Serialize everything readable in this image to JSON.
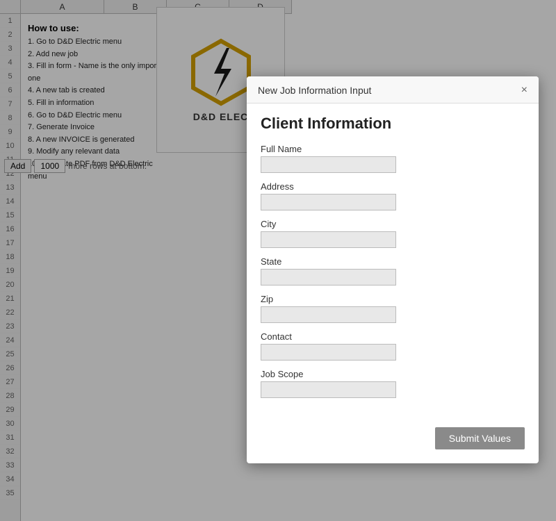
{
  "spreadsheet": {
    "col_headers": [
      "A",
      "B",
      "C",
      "D"
    ],
    "row_numbers": [
      "1",
      "2",
      "3",
      "4",
      "5",
      "6",
      "7",
      "8",
      "9",
      "10",
      "11",
      "12",
      "13",
      "14",
      "15",
      "16",
      "17",
      "18",
      "19",
      "20",
      "21",
      "22",
      "23",
      "24",
      "25",
      "26",
      "27",
      "28",
      "29",
      "30",
      "31",
      "32",
      "33",
      "34",
      "35"
    ],
    "how_to": {
      "title": "How to use:",
      "steps": [
        "1. Go to D&D Electric menu",
        "2. Add new job",
        "3. Fill in form - Name is the only important one",
        "4. A new tab is created",
        "5. Fill in information",
        "6. Go to D&D Electric menu",
        "7. Generate Invoice",
        "8. A new INVOICE is generated",
        "9. Modify any relevant data",
        "10. Generate PDF from D&D Electric menu"
      ]
    },
    "add_rows": {
      "button_label": "Add",
      "rows_value": "1000",
      "suffix_text": "more rows at bottom."
    },
    "logo": {
      "company_name": "D&D ELEC"
    }
  },
  "modal": {
    "title": "New Job Information Input",
    "close_label": "×",
    "section_heading": "Client Information",
    "fields": [
      {
        "label": "Full Name",
        "placeholder": "",
        "name": "full-name-input"
      },
      {
        "label": "Address",
        "placeholder": "",
        "name": "address-input"
      },
      {
        "label": "City",
        "placeholder": "",
        "name": "city-input"
      },
      {
        "label": "State",
        "placeholder": "",
        "name": "state-input"
      },
      {
        "label": "Zip",
        "placeholder": "",
        "name": "zip-input"
      },
      {
        "label": "Contact",
        "placeholder": "",
        "name": "contact-input"
      },
      {
        "label": "Job Scope",
        "placeholder": "",
        "name": "job-scope-input"
      }
    ],
    "submit_button": "Submit Values"
  }
}
